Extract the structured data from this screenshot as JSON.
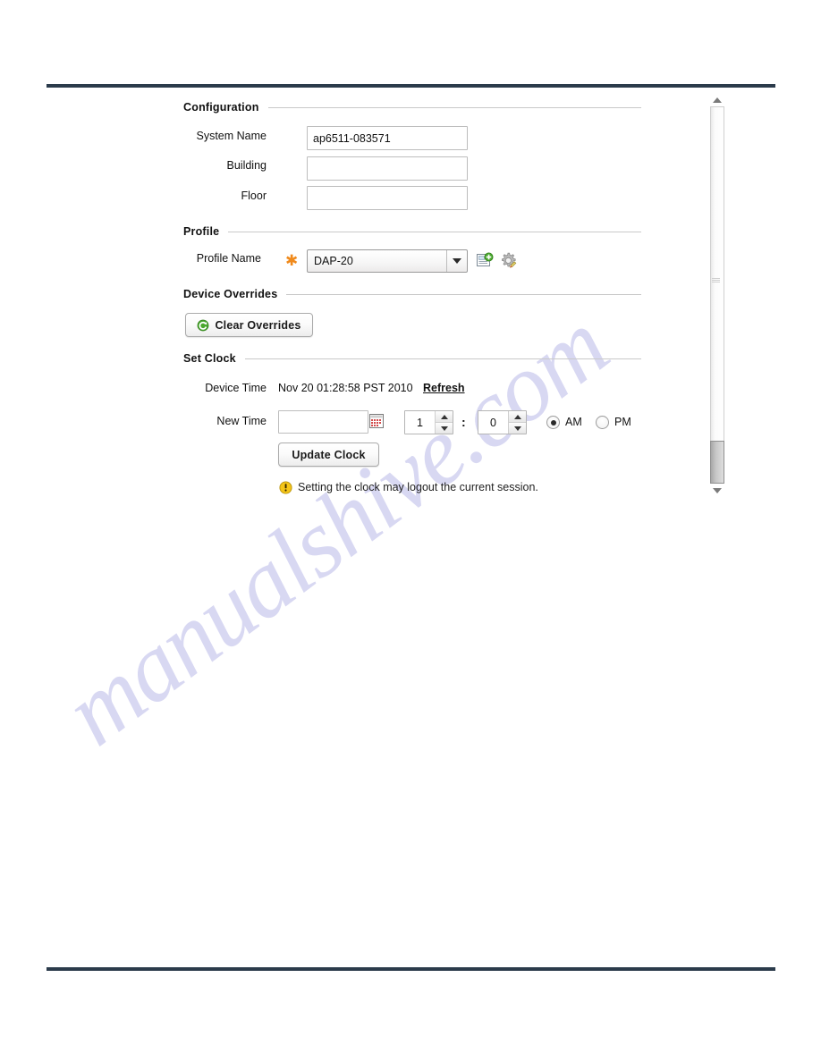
{
  "watermark": {
    "text": "manualshive.com"
  },
  "sections": {
    "configuration": {
      "title": "Configuration",
      "fields": [
        {
          "label": "System Name",
          "value": "ap6511-083571",
          "placeholder": ""
        },
        {
          "label": "Building",
          "value": "",
          "placeholder": ""
        },
        {
          "label": "Floor",
          "value": "",
          "placeholder": ""
        }
      ]
    },
    "profile": {
      "title": "Profile",
      "field_label": "Profile Name",
      "required_marker": "✱",
      "selected_option": "DAP-20",
      "options": [
        "DAP-20"
      ],
      "icons": {
        "create_new": "new-profile-icon",
        "edit_settings": "edit-profile-gear-icon"
      }
    },
    "device_overrides": {
      "title": "Device Overrides",
      "clear_button_label": "Clear Overrides",
      "clear_button_icon": "refresh-circle-icon"
    },
    "set_clock": {
      "title": "Set Clock",
      "device_time_label": "Device Time",
      "device_time_value": "Nov 20 01:28:58 PST 2010",
      "refresh_link": "Refresh",
      "new_time_label": "New Time",
      "new_time_value": "",
      "new_time_placeholder": "",
      "calendar_icon": "calendar-picker-icon",
      "hour_value": "1",
      "minute_value": "0",
      "time_separator": ":",
      "meridiem": {
        "am_label": "AM",
        "pm_label": "PM",
        "selected": "AM"
      },
      "update_button_label": "Update Clock",
      "warning_icon": "warning-exclamation-icon",
      "warning_text": "Setting the clock may logout the current session."
    }
  },
  "scrollbar": {
    "up_arrow": "scroll-up-arrow-icon",
    "down_arrow": "scroll-down-arrow-icon"
  },
  "colors": {
    "page_rule": "#2b3b4b",
    "required_star": "#f08a1c",
    "warning": "#f2c000",
    "accent_green": "#4aa82e"
  }
}
